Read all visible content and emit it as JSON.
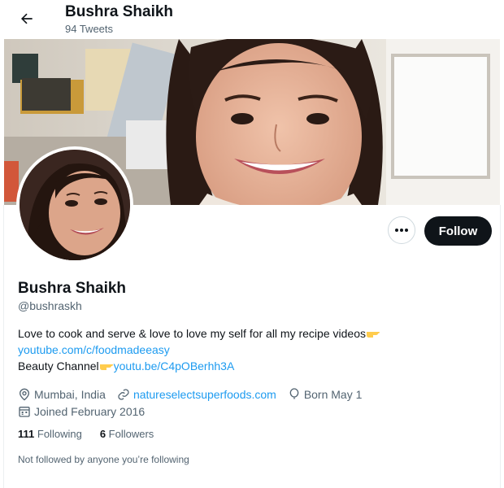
{
  "header": {
    "title": "Bushra Shaikh",
    "tweet_count": "94 Tweets"
  },
  "profile": {
    "display_name": "Bushra Shaikh",
    "handle": "@bushraskh",
    "bio_line1": "Love to cook and serve & love to love my self for all my recipe videos",
    "bio_link1": "youtube.com/c/foodmadeeasy",
    "bio_line3_text": "Beauty Channel",
    "bio_link2": "youtu.be/C4pOBerhh3A",
    "location": "Mumbai, India",
    "website": "natureselectsuperfoods.com",
    "birthday": "Born May 1",
    "joined": "Joined February 2016"
  },
  "stats": {
    "following_count": "111",
    "following_label": "Following",
    "followers_count": "6",
    "followers_label": "Followers"
  },
  "actions": {
    "follow_label": "Follow"
  },
  "followed_by_note": "Not followed by anyone you’re following",
  "icons": {
    "back": "arrow-left-icon",
    "more": "more-horizontal-icon",
    "location": "map-pin-icon",
    "website": "link-icon",
    "birthday": "balloon-icon",
    "joined": "calendar-icon",
    "emoji": "pointing-hand-emoji"
  },
  "colors": {
    "link": "#1d9bf0",
    "button_dark": "#0f1419",
    "secondary_text": "#536471"
  }
}
